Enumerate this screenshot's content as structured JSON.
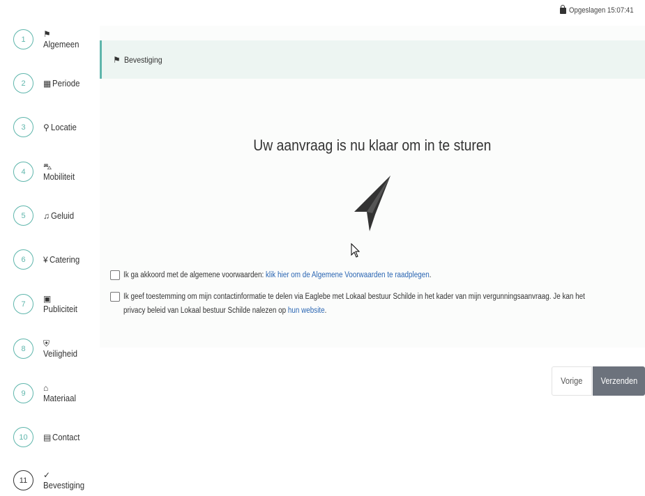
{
  "status": {
    "saved_text": "Opgeslagen 15:07:41",
    "icon": "save-icon"
  },
  "steps": [
    {
      "number": "1",
      "label": "Algemeen",
      "icon": "flag-icon",
      "glyph": "⚑"
    },
    {
      "number": "2",
      "label": "Periode",
      "icon": "calendar-icon",
      "glyph": "▦"
    },
    {
      "number": "3",
      "label": "Locatie",
      "icon": "map-pin-icon",
      "glyph": "⚲"
    },
    {
      "number": "4",
      "label": "Mobiliteit",
      "icon": "car-icon",
      "glyph": "⛍"
    },
    {
      "number": "5",
      "label": "Geluid",
      "icon": "music-icon",
      "glyph": "♫"
    },
    {
      "number": "6",
      "label": "Catering",
      "icon": "utensils-icon",
      "glyph": "¥"
    },
    {
      "number": "7",
      "label": "Publiciteit",
      "icon": "ad-icon",
      "glyph": "▣"
    },
    {
      "number": "8",
      "label": "Veiligheid",
      "icon": "users-shield-icon",
      "glyph": "⛨"
    },
    {
      "number": "9",
      "label": "Materiaal",
      "icon": "warehouse-icon",
      "glyph": "⌂"
    },
    {
      "number": "10",
      "label": "Contact",
      "icon": "address-card-icon",
      "glyph": "▤"
    },
    {
      "number": "11",
      "label": "Bevestiging",
      "icon": "clipboard-check-icon",
      "glyph": "✓"
    }
  ],
  "panel": {
    "header_title": "Bevestiging",
    "header_icon_glyph": "⚑",
    "main_title": "Uw aanvraag is nu klaar om in te sturen"
  },
  "consent": {
    "terms_text": "Ik ga akkoord met de algemene voorwaarden: ",
    "terms_link": "klik hier om de Algemene Voorwaarden te raadplegen",
    "terms_end": ".",
    "privacy_text_1": "Ik geef toestemming om mijn contactinformatie te delen via Eaglebe met Lokaal bestuur Schilde in het kader van mijn vergunningsaanvraag. Je kan het",
    "privacy_text_2": "privacy beleid van Lokaal bestuur Schilde nalezen op ",
    "privacy_link": "hun website",
    "privacy_end": "."
  },
  "actions": {
    "previous_label": "Vorige",
    "submit_label": "Verzenden"
  },
  "colors": {
    "accent": "#5fb6ac",
    "header_bg": "#edf5f2",
    "link": "#2b66b3",
    "submit_bg": "#6c727c"
  }
}
